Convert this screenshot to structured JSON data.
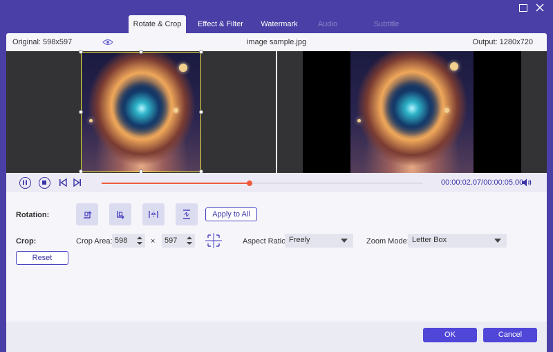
{
  "tabs": [
    {
      "label": "Rotate & Crop",
      "state": "active"
    },
    {
      "label": "Effect & Filter",
      "state": "normal"
    },
    {
      "label": "Watermark",
      "state": "normal"
    },
    {
      "label": "Audio",
      "state": "disabled"
    },
    {
      "label": "Subtitle",
      "state": "disabled"
    }
  ],
  "info": {
    "original": "Original: 598x597",
    "filename": "image sample.jpg",
    "output": "Output: 1280x720"
  },
  "playback": {
    "current_time": "00:00:02.07",
    "separator": "/",
    "total_time": "00:00:05.00",
    "progress": 0.46
  },
  "rotation": {
    "label": "Rotation:",
    "buttons": [
      "rotate-left",
      "rotate-right",
      "flip-horizontal",
      "flip-vertical"
    ],
    "apply_all": "Apply to All"
  },
  "crop": {
    "label": "Crop:",
    "area_label": "Crop Area:",
    "width": "598",
    "times": "×",
    "height": "597",
    "aspect_label": "Aspect Ratio:",
    "aspect_value": "Freely",
    "zoom_label": "Zoom Mode:",
    "zoom_value": "Letter Box",
    "reset": "Reset"
  },
  "footer": {
    "ok": "OK",
    "cancel": "Cancel"
  },
  "colors": {
    "accent": "#4b44c2",
    "window": "#4a3fa6",
    "progress": "#f05a3c",
    "crop_frame": "#f0e23c"
  }
}
